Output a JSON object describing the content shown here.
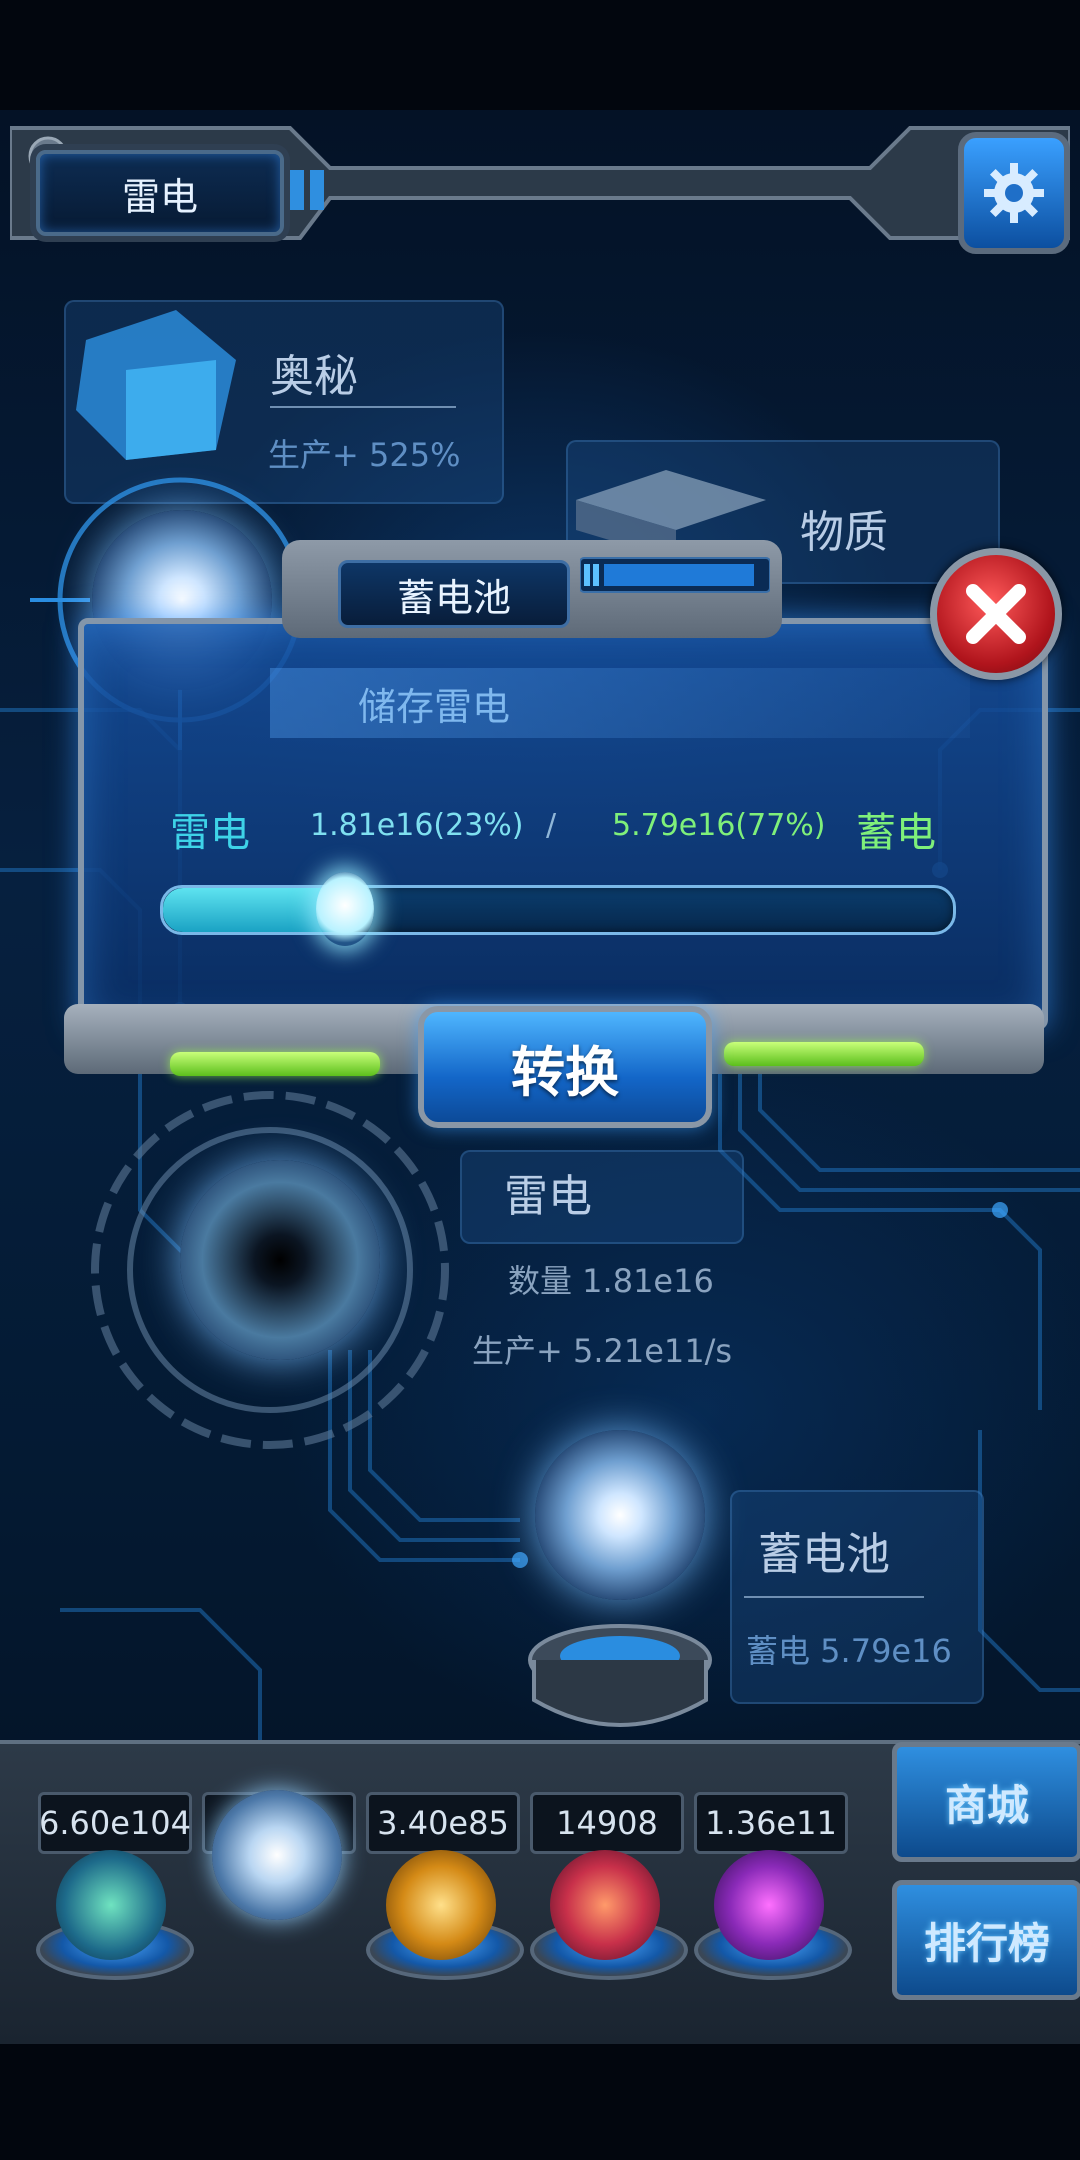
{
  "header": {
    "title": "雷电",
    "settings_icon": "gear-icon"
  },
  "background_cards": {
    "mystery": {
      "title": "奥秘",
      "sub": "生产+ 525%"
    },
    "matter": {
      "title": "物质"
    },
    "lightning": {
      "title": "雷电",
      "count": "数量 1.81e16",
      "rate": "生产+ 5.21e11/s"
    },
    "battery": {
      "title": "蓄电池",
      "stored": "蓄电 5.79e16"
    }
  },
  "dialog": {
    "title": "蓄电池",
    "subtitle": "储存雷电",
    "left_label": "雷电",
    "left_value": "1.81e16(23%)",
    "separator": "/",
    "right_value": "5.79e16(77%)",
    "right_label": "蓄电",
    "slider_fraction": 0.23,
    "convert_label": "转换",
    "close_icon": "close-icon"
  },
  "resource_bar": {
    "counters": [
      "6.60e104",
      "1      6",
      "3.40e85",
      "14908",
      "1.36e11"
    ],
    "slots": [
      "atom-orb-icon",
      "lightning-orb-icon",
      "fire-orb-icon",
      "brain-orb-icon",
      "vortex-orb-icon"
    ]
  },
  "side_buttons": {
    "shop": "商城",
    "ranking": "排行榜"
  },
  "colors": {
    "accent_cyan": "#3ed3e8",
    "accent_green": "#7ff07a",
    "close_red": "#d01e28"
  }
}
